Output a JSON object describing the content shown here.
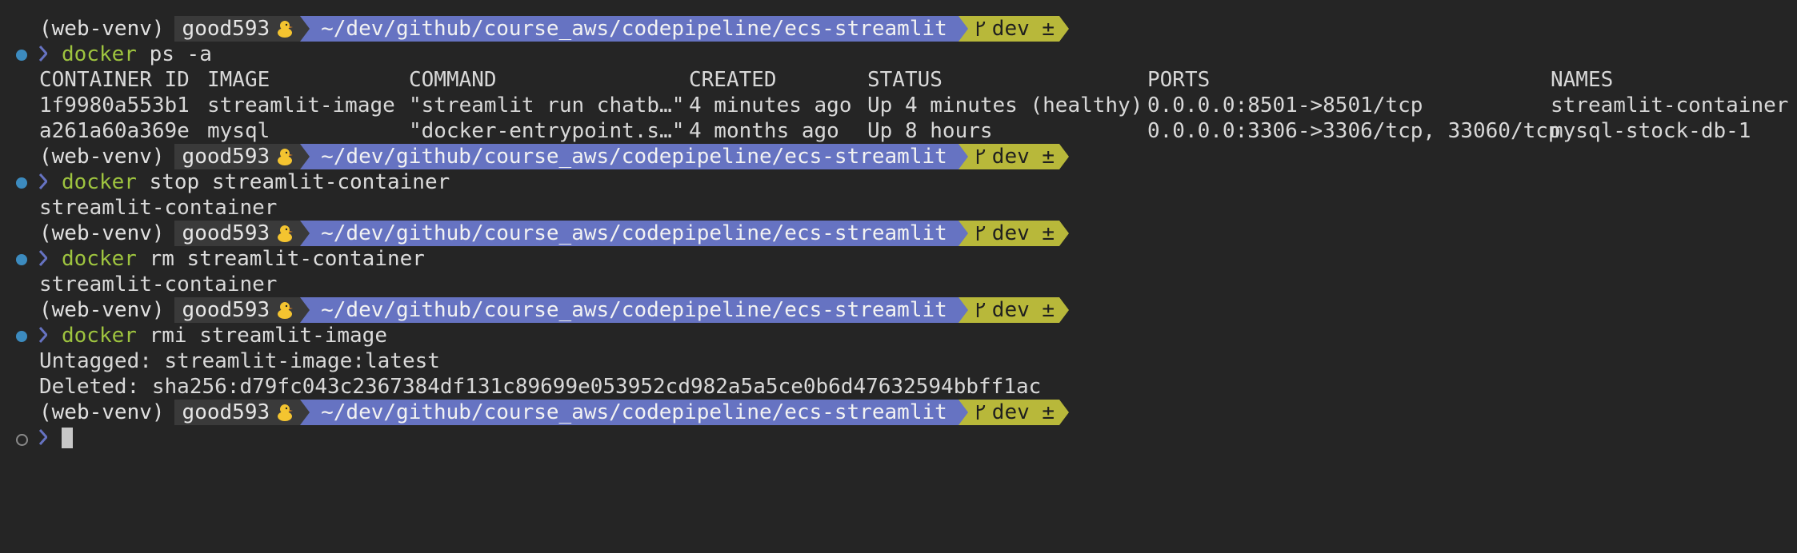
{
  "prompt": {
    "venv": "(web-venv)",
    "user": "good593",
    "user_icon": "duck-emoji-icon",
    "path": "~/dev/github/course_aws/codepipeline/ecs-streamlit",
    "branch": "dev ±"
  },
  "colors": {
    "background": "#252525",
    "command": "#9ec43f",
    "path_segment": "#6673c2",
    "git_segment": "#b8b83a",
    "user_segment": "#3a3a3a",
    "status_dot": "#3c8bbf"
  },
  "commands": {
    "ps": {
      "cmd": "docker",
      "args": " ps -a"
    },
    "stop": {
      "cmd": "docker",
      "args": " stop streamlit-container"
    },
    "rm": {
      "cmd": "docker",
      "args": " rm streamlit-container"
    },
    "rmi": {
      "cmd": "docker",
      "args": " rmi streamlit-image"
    }
  },
  "ps_table": {
    "headers": [
      "CONTAINER ID",
      "IMAGE",
      "COMMAND",
      "CREATED",
      "STATUS",
      "PORTS",
      "NAMES"
    ],
    "rows": [
      [
        "1f9980a553b1",
        "streamlit-image",
        "\"streamlit run chatb…\"",
        "4 minutes ago",
        "Up 4 minutes (healthy)",
        "0.0.0.0:8501->8501/tcp",
        "streamlit-container"
      ],
      [
        "a261a60a369e",
        "mysql",
        "\"docker-entrypoint.s…\"",
        "4 months ago",
        "Up 8 hours",
        "0.0.0.0:3306->3306/tcp, 33060/tcp",
        "mysql-stock-db-1"
      ]
    ]
  },
  "outputs": {
    "stop": "streamlit-container",
    "rm": "streamlit-container",
    "rmi": [
      "Untagged: streamlit-image:latest",
      "Deleted: sha256:d79fc043c2367384df131c89699e053952cd982a5a5ce0b6d47632594bbff1ac"
    ]
  }
}
